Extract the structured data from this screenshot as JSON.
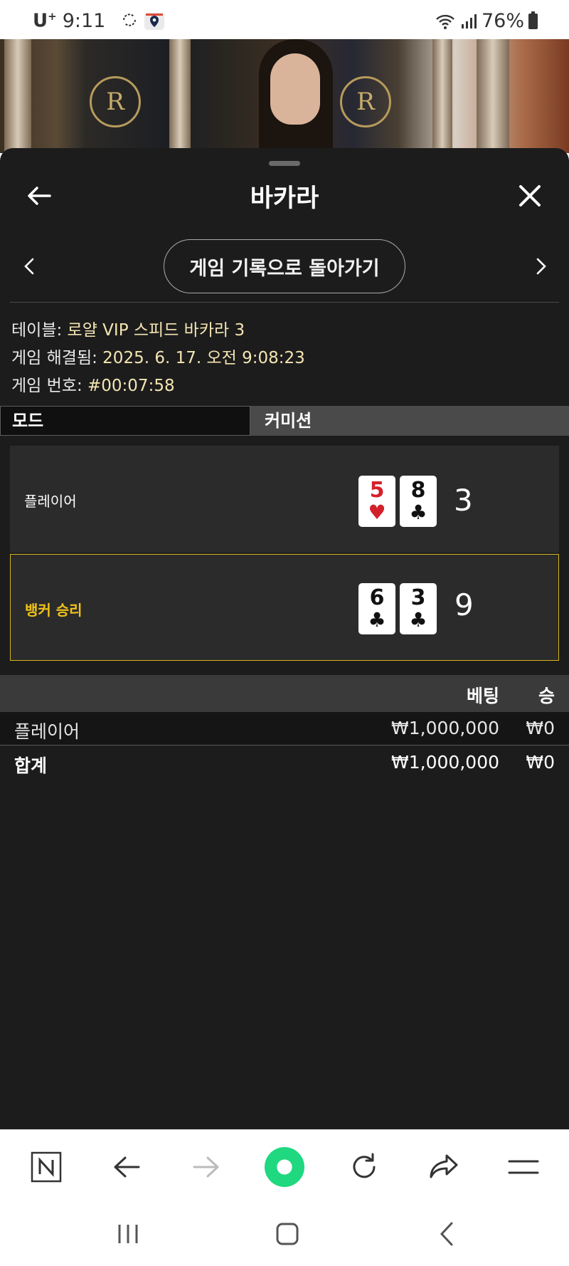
{
  "status_bar": {
    "carrier": "U",
    "carrier_sup": "+",
    "time": "9:11",
    "battery": "76%"
  },
  "header": {
    "title": "바카라"
  },
  "nav": {
    "back_to_history": "게임 기록으로 돌아가기"
  },
  "info": {
    "table_label": "테이블: ",
    "table_value": "로얄 VIP 스피드 바카라 3",
    "resolved_label": "게임 해결됨: ",
    "resolved_value": "2025. 6. 17. 오전 9:08:23",
    "game_no_label": "게임 번호: ",
    "game_no_value": "#00:07:58"
  },
  "mode": {
    "left": "모드",
    "right": "커미션"
  },
  "hands": {
    "player": {
      "label": "플레이어",
      "cards": [
        {
          "rank": "5",
          "suit": "♥",
          "color": "red"
        },
        {
          "rank": "8",
          "suit": "♣",
          "color": "black"
        }
      ],
      "score": "3"
    },
    "banker": {
      "label": "뱅커 승리",
      "cards": [
        {
          "rank": "6",
          "suit": "♣",
          "color": "black"
        },
        {
          "rank": "3",
          "suit": "♣",
          "color": "black"
        }
      ],
      "score": "9"
    }
  },
  "bets": {
    "col_bet": "베팅",
    "col_win": "승",
    "rows": [
      {
        "name": "플레이어",
        "bet": "₩1,000,000",
        "win": "₩0"
      }
    ],
    "total": {
      "name": "합계",
      "bet": "₩1,000,000",
      "win": "₩0"
    }
  },
  "colors": {
    "win_highlight": "#d4b51f",
    "sheet_bg": "#1c1c1c",
    "accent_green": "#1fd87f"
  },
  "icons": {
    "header_back": "arrow-left-icon",
    "header_close": "close-icon",
    "prev": "chevron-left-icon",
    "next": "chevron-right-icon"
  }
}
